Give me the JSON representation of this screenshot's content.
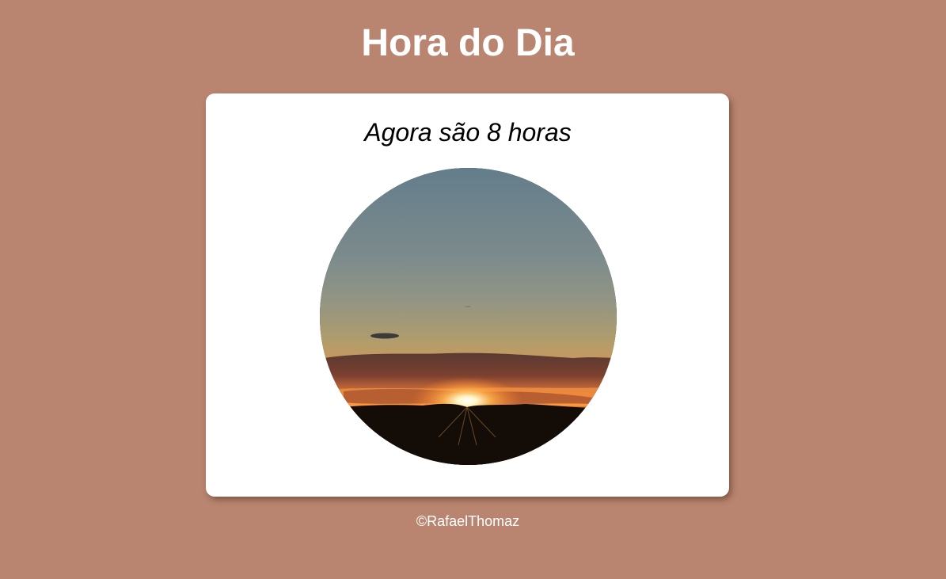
{
  "header": {
    "title": "Hora do Dia"
  },
  "card": {
    "message": "Agora são 8 horas",
    "image": {
      "subject": "sunrise-over-horizon"
    }
  },
  "footer": {
    "copyright": "©RafaelThomaz"
  },
  "colors": {
    "background": "#b98570",
    "card": "#ffffff",
    "title": "#ffffff",
    "text": "#000000"
  }
}
